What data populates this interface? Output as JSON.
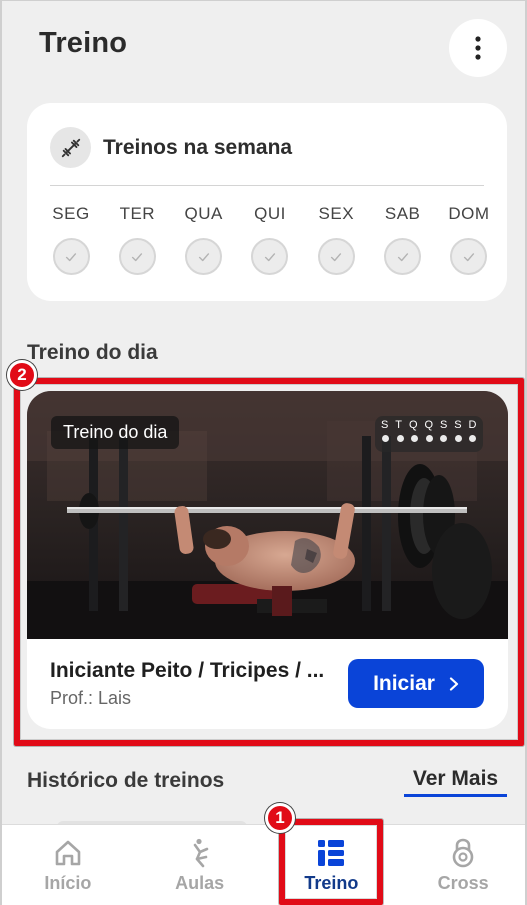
{
  "header": {
    "title": "Treino",
    "more_icon": "more-vertical-icon"
  },
  "week": {
    "title": "Treinos na semana",
    "icon": "dumbbell-icon",
    "days": [
      {
        "label": "SEG",
        "done": false
      },
      {
        "label": "TER",
        "done": false
      },
      {
        "label": "QUA",
        "done": false
      },
      {
        "label": "QUI",
        "done": false
      },
      {
        "label": "SEX",
        "done": false
      },
      {
        "label": "SAB",
        "done": false
      },
      {
        "label": "DOM",
        "done": false
      }
    ]
  },
  "today": {
    "section_title": "Treino do dia",
    "card": {
      "tag": "Treino do dia",
      "mini_days": [
        "S",
        "T",
        "Q",
        "Q",
        "S",
        "S",
        "D"
      ],
      "name": "Iniciante Peito / Tricipes / ...",
      "professor": "Prof.: Lais",
      "start_label": "Iniciar"
    }
  },
  "history": {
    "title": "Histórico de treinos",
    "see_more": "Ver Mais"
  },
  "nav": {
    "items": [
      {
        "label": "Início",
        "icon": "home-icon",
        "active": false
      },
      {
        "label": "Aulas",
        "icon": "stretch-icon",
        "active": false
      },
      {
        "label": "Treino",
        "icon": "dashboard-icon",
        "active": true
      },
      {
        "label": "Cross",
        "icon": "kettlebell-icon",
        "active": false
      }
    ]
  },
  "annotations": [
    {
      "number": "1",
      "target": "nav-treino"
    },
    {
      "number": "2",
      "target": "workout-card"
    }
  ],
  "colors": {
    "accent": "#0a44d8",
    "annotation": "#e10b17",
    "nav_active": "#123a8a"
  }
}
